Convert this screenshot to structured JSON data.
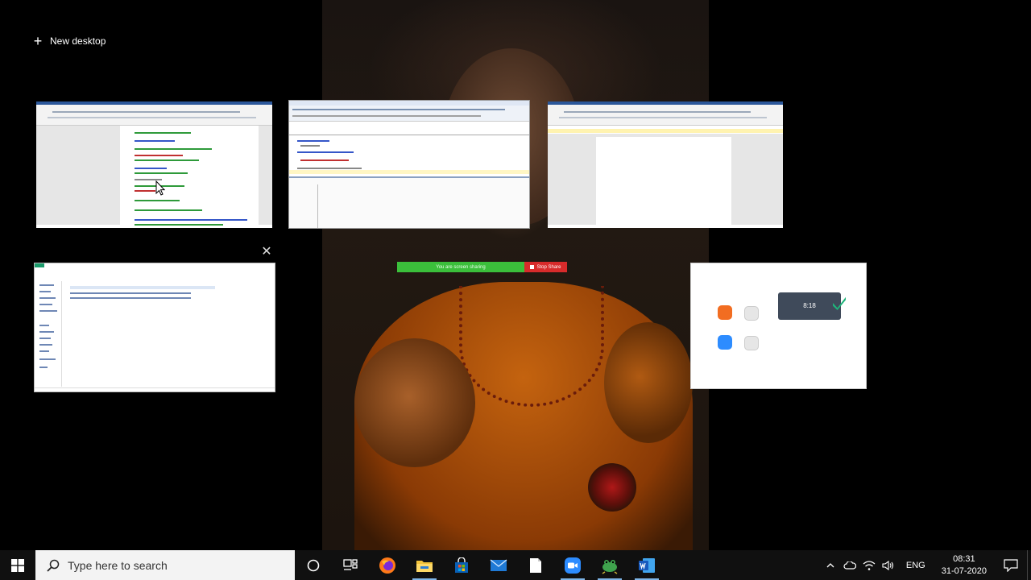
{
  "task_view": {
    "new_desktop_label": "New desktop",
    "close_glyph": "✕"
  },
  "zoom_share_bar": {
    "sharing_text": "You are screen sharing",
    "stop_label": "Stop Share"
  },
  "zoom_window": {
    "clock": "8:18"
  },
  "taskbar": {
    "search_placeholder": "Type here to search",
    "language": "ENG",
    "time": "08:31",
    "date": "31-07-2020",
    "pinned": [
      "firefox-icon",
      "file-explorer-icon",
      "microsoft-store-icon",
      "mail-icon",
      "notepad-icon",
      "zoom-icon",
      "frog-app-icon",
      "word-icon"
    ]
  },
  "colors": {
    "word_blue": "#2b579a",
    "share_green": "#3bbf3b",
    "share_red": "#d82b2b",
    "taskbar": "#101010",
    "zoom_orange": "#f26d21",
    "zoom_blue": "#2d8cff"
  }
}
